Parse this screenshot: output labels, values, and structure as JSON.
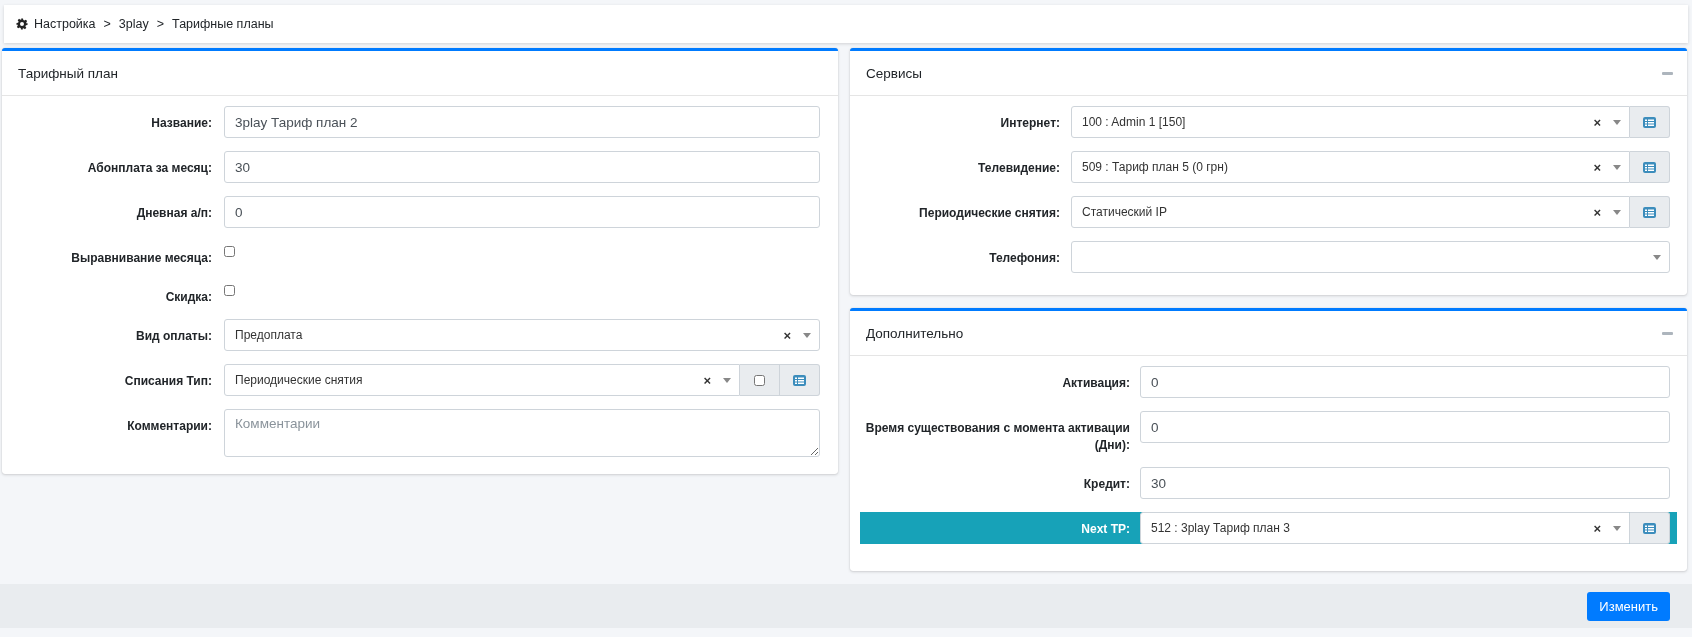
{
  "breadcrumb": [
    {
      "label": "Настройка"
    },
    {
      "separator": ">",
      "label": "3play"
    },
    {
      "separator": ">",
      "label": "Тарифные планы"
    }
  ],
  "panels": [
    {
      "title": "Тарифный план",
      "fields": [
        {
          "kind": "text",
          "label": "Название:",
          "value": "3play Тариф план 2"
        },
        {
          "kind": "text",
          "label": "Абонплата за месяц:",
          "value": "30"
        },
        {
          "kind": "text",
          "label": "Дневная а/п:",
          "value": "0"
        },
        {
          "kind": "checkbox",
          "label": "Выравнивание месяца:",
          "checked": false
        },
        {
          "kind": "checkbox",
          "label": "Скидка:",
          "checked": false
        },
        {
          "kind": "select",
          "label": "Вид оплаты:",
          "value": "Предоплата",
          "clear": "×"
        },
        {
          "kind": "select",
          "label": "Списания Тип:",
          "value": "Периодические снятия",
          "clear": "×",
          "addon_checkbox": {
            "checked": false
          },
          "list_button": true
        },
        {
          "kind": "textarea",
          "label": "Комментарии:",
          "placeholder": "Комментарии"
        }
      ]
    },
    {
      "title": "Сервисы",
      "collapse_button": true,
      "fields": [
        {
          "kind": "select",
          "label": "Интернет:",
          "value": "100 : Admin 1 [150]",
          "clear": "×",
          "list_button": true
        },
        {
          "kind": "select",
          "label": "Телевидение:",
          "value": "509 : Тариф план 5 (0 грн)",
          "clear": "×",
          "list_button": true
        },
        {
          "kind": "select",
          "label": "Периодические снятия:",
          "value": "Статический IP",
          "clear": "×",
          "list_button": true
        },
        {
          "kind": "select",
          "label": "Телефония:"
        }
      ]
    },
    {
      "title": "Дополнительно",
      "collapse_button": true,
      "fields": [
        {
          "kind": "text",
          "label": "Активация:",
          "value": "0"
        },
        {
          "kind": "text",
          "label": "Время существования с момента активации (Дни):",
          "value": "0"
        },
        {
          "kind": "text",
          "label": "Кредит:",
          "value": "30"
        },
        {
          "kind": "select",
          "label": "Next TP:",
          "value": "512 : 3play Тариф план 3",
          "clear": "×",
          "list_button": true,
          "highlighted": true
        }
      ]
    }
  ],
  "footer": {
    "button": "Изменить"
  }
}
